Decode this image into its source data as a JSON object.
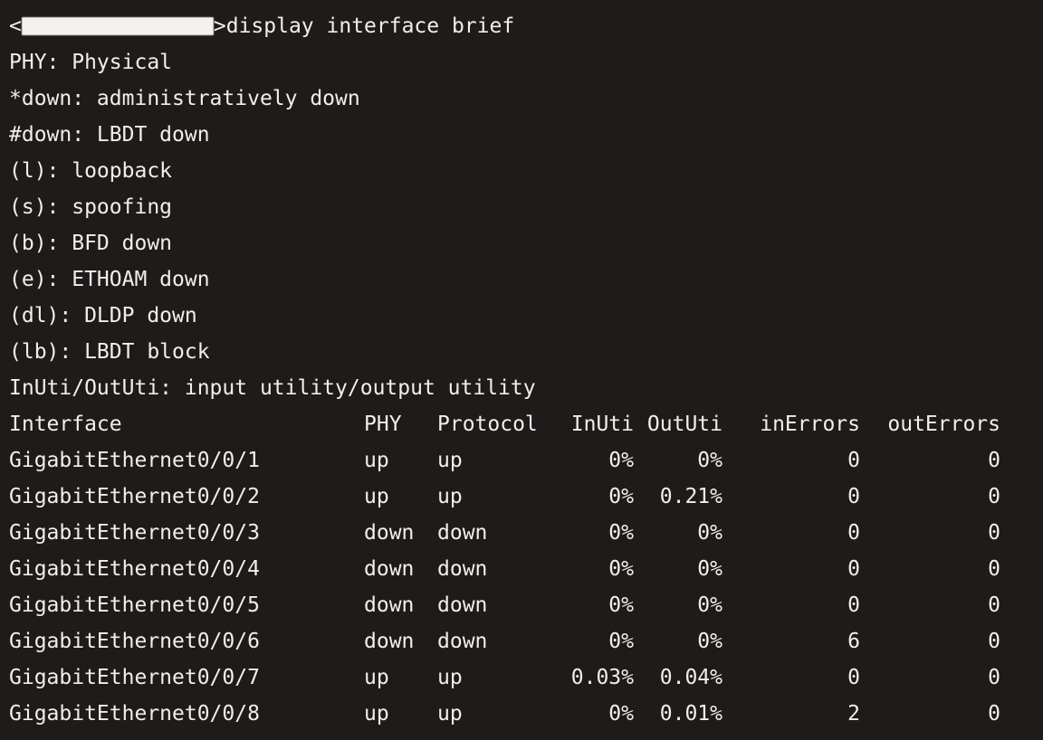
{
  "terminal": {
    "background_color": "#1e1b1b",
    "foreground_color": "#f2eeec",
    "clipped_top_line": "",
    "prompt": {
      "open_bracket": "<",
      "hostname_redacted": "",
      "close_bracket": ">",
      "command": "display interface brief"
    },
    "legend": [
      "PHY: Physical",
      "*down: administratively down",
      "#down: LBDT down",
      "(l): loopback",
      "(s): spoofing",
      "(b): BFD down",
      "(e): ETHOAM down",
      "(dl): DLDP down",
      "(lb): LBDT block",
      "InUti/OutUti: input utility/output utility"
    ],
    "table": {
      "headers": {
        "interface": "Interface",
        "phy": "PHY",
        "protocol": "Protocol",
        "inuti": "InUti",
        "oututi": "OutUti",
        "inerrors": "inErrors",
        "outerrors": "outErrors"
      },
      "rows": [
        {
          "interface": "GigabitEthernet0/0/1",
          "phy": "up",
          "protocol": "up",
          "inuti": "0%",
          "oututi": "0%",
          "inerrors": "0",
          "outerrors": "0"
        },
        {
          "interface": "GigabitEthernet0/0/2",
          "phy": "up",
          "protocol": "up",
          "inuti": "0%",
          "oututi": "0.21%",
          "inerrors": "0",
          "outerrors": "0"
        },
        {
          "interface": "GigabitEthernet0/0/3",
          "phy": "down",
          "protocol": "down",
          "inuti": "0%",
          "oututi": "0%",
          "inerrors": "0",
          "outerrors": "0"
        },
        {
          "interface": "GigabitEthernet0/0/4",
          "phy": "down",
          "protocol": "down",
          "inuti": "0%",
          "oututi": "0%",
          "inerrors": "0",
          "outerrors": "0"
        },
        {
          "interface": "GigabitEthernet0/0/5",
          "phy": "down",
          "protocol": "down",
          "inuti": "0%",
          "oututi": "0%",
          "inerrors": "0",
          "outerrors": "0"
        },
        {
          "interface": "GigabitEthernet0/0/6",
          "phy": "down",
          "protocol": "down",
          "inuti": "0%",
          "oututi": "0%",
          "inerrors": "6",
          "outerrors": "0"
        },
        {
          "interface": "GigabitEthernet0/0/7",
          "phy": "up",
          "protocol": "up",
          "inuti": "0.03%",
          "oututi": "0.04%",
          "inerrors": "0",
          "outerrors": "0"
        },
        {
          "interface": "GigabitEthernet0/0/8",
          "phy": "up",
          "protocol": "up",
          "inuti": "0%",
          "oututi": "0.01%",
          "inerrors": "2",
          "outerrors": "0"
        }
      ]
    }
  }
}
